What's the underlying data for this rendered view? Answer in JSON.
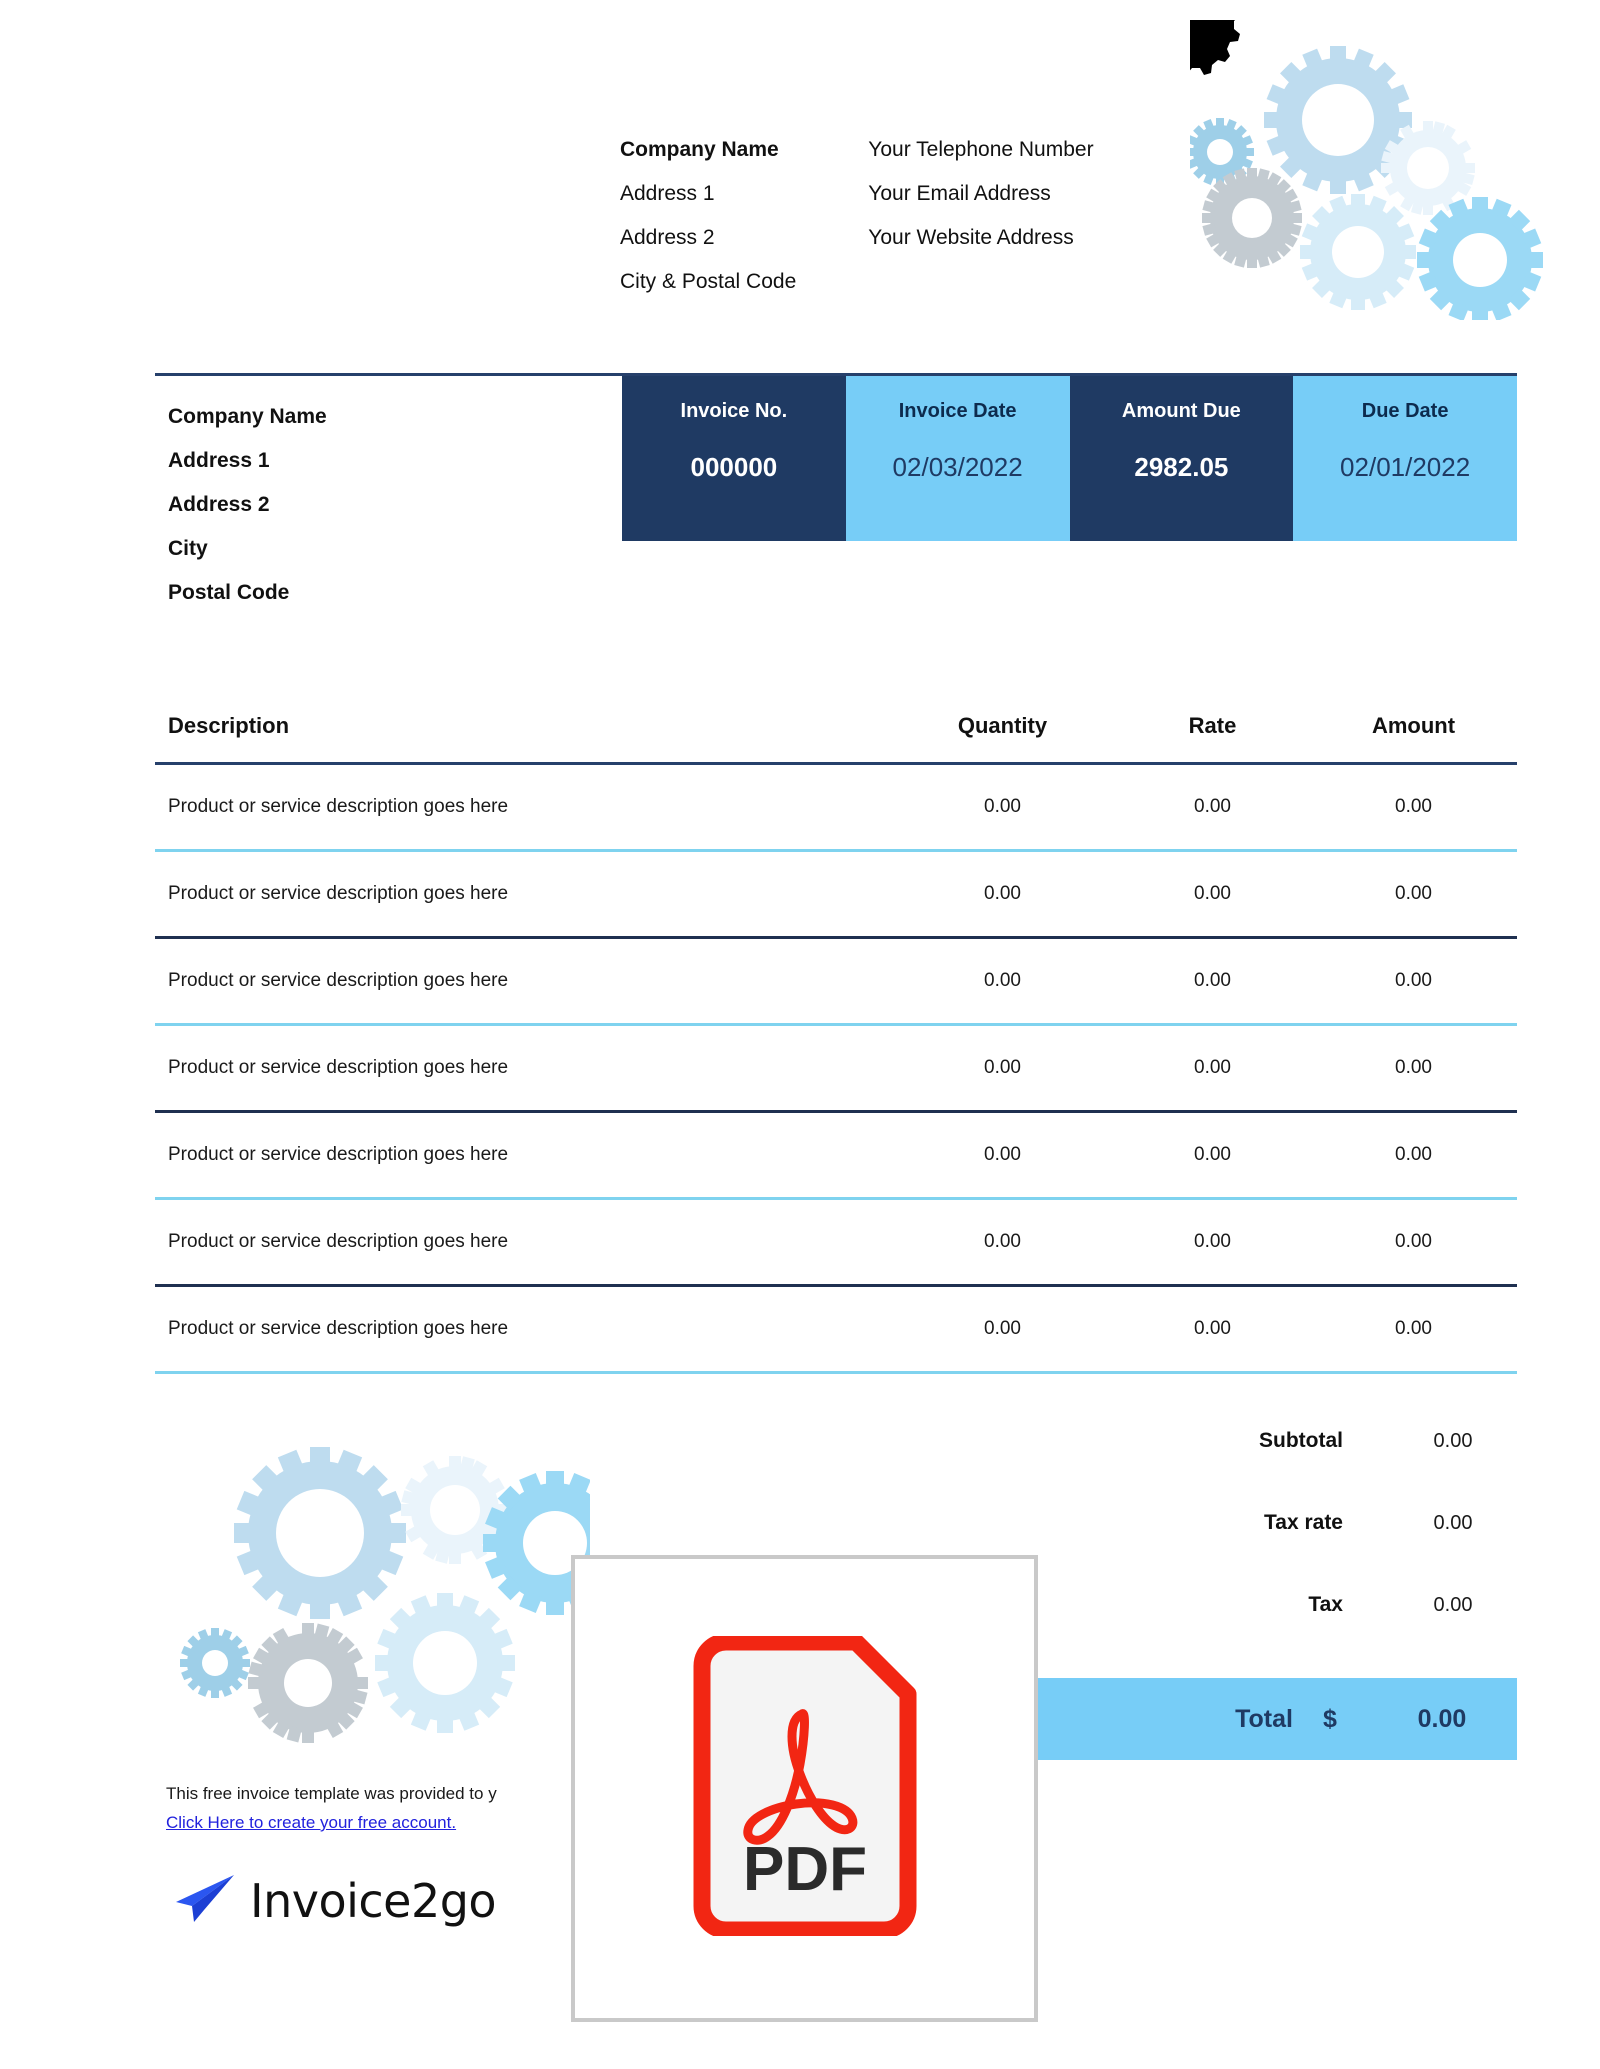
{
  "header": {
    "company_block": [
      "Company Name",
      "Address 1",
      "Address 2",
      "City & Postal Code"
    ],
    "contact_block": [
      "Your Telephone Number",
      "Your Email Address",
      "Your Website Address"
    ]
  },
  "bill_to": [
    "Company Name",
    "Address 1",
    "Address 2",
    "City",
    "Postal Code"
  ],
  "meta": [
    {
      "label": "Invoice No.",
      "value": "000000",
      "style": "dark"
    },
    {
      "label": "Invoice Date",
      "value": "02/03/2022",
      "style": "light"
    },
    {
      "label": "Amount Due",
      "value": "2982.05",
      "style": "dark"
    },
    {
      "label": "Due Date",
      "value": "02/01/2022",
      "style": "light"
    }
  ],
  "table": {
    "columns": [
      "Description",
      "Quantity",
      "Rate",
      "Amount"
    ],
    "rows": [
      {
        "description": "Product or service description goes here",
        "quantity": "0.00",
        "rate": "0.00",
        "amount": "0.00",
        "separator": "cyan"
      },
      {
        "description": "Product or service description goes here",
        "quantity": "0.00",
        "rate": "0.00",
        "amount": "0.00",
        "separator": "navy"
      },
      {
        "description": "Product or service description goes here",
        "quantity": "0.00",
        "rate": "0.00",
        "amount": "0.00",
        "separator": "cyan"
      },
      {
        "description": "Product or service description goes here",
        "quantity": "0.00",
        "rate": "0.00",
        "amount": "0.00",
        "separator": "navy"
      },
      {
        "description": "Product or service description goes here",
        "quantity": "0.00",
        "rate": "0.00",
        "amount": "0.00",
        "separator": "cyan"
      },
      {
        "description": "Product or service description goes here",
        "quantity": "0.00",
        "rate": "0.00",
        "amount": "0.00",
        "separator": "navy"
      },
      {
        "description": "Product or service description goes here",
        "quantity": "0.00",
        "rate": "0.00",
        "amount": "0.00",
        "separator": "cyan"
      }
    ]
  },
  "totals": {
    "rows": [
      {
        "label": "Subtotal",
        "value": "0.00"
      },
      {
        "label": "Tax rate",
        "value": "0.00"
      },
      {
        "label": "Tax",
        "value": "0.00"
      }
    ],
    "total": {
      "label": "Total",
      "currency": "$",
      "value": "0.00"
    }
  },
  "footer": {
    "note": "This free invoice template was provided to y",
    "link": "Click Here to create your free account.",
    "brand_name": "Invoice2go",
    "brand_icon": "paper-plane-icon"
  },
  "overlay": {
    "label": "PDF",
    "icon": "pdf-document-icon"
  },
  "colors": {
    "navy": "#1f3a63",
    "light_blue": "#77cdf7",
    "cyan_rule": "#7fd3ef",
    "navy_rule": "#1f3050",
    "link": "#2222dd",
    "pdf_red": "#f22613",
    "brand_blue": "#2b56f0"
  }
}
